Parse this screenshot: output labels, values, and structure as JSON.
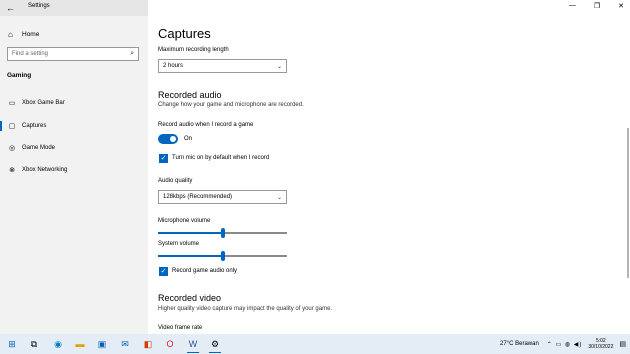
{
  "app": {
    "title": "Settings"
  },
  "sidebar": {
    "home_label": "Home",
    "search_placeholder": "Find a setting",
    "section_title": "Gaming",
    "items": [
      {
        "label": "Xbox Game Bar",
        "icon": "xbox-icon"
      },
      {
        "label": "Captures",
        "icon": "capture-icon"
      },
      {
        "label": "Game Mode",
        "icon": "gamemode-icon"
      },
      {
        "label": "Xbox Networking",
        "icon": "xbox-icon"
      }
    ]
  },
  "main": {
    "title": "Captures",
    "max_length_label": "Maximum recording length",
    "max_length_value": "2 hours",
    "recorded_audio": {
      "heading": "Recorded audio",
      "description": "Change how your game and microphone are recorded.",
      "toggle_label": "Record audio when I record a game",
      "toggle_state": "On",
      "mic_checkbox_label": "Turn mic on by default when I record",
      "quality_label": "Audio quality",
      "quality_value": "128kbps (Recommended)",
      "mic_volume_label": "Microphone volume",
      "mic_volume": 0.5,
      "system_volume_label": "System volume",
      "system_volume": 0.5,
      "game_audio_only_label": "Record game audio only"
    },
    "recorded_video": {
      "heading": "Recorded video",
      "description": "Higher quality video capture may impact the quality of your game.",
      "frame_rate_label": "Video frame rate"
    }
  },
  "taskbar": {
    "weather": "27°C  Berawan",
    "time": "5:02",
    "date": "30/10/2022"
  },
  "colors": {
    "accent": "#0067c0",
    "sidebar_bg": "#f2f2f2",
    "taskbar_bg": "#e4ecf5"
  }
}
